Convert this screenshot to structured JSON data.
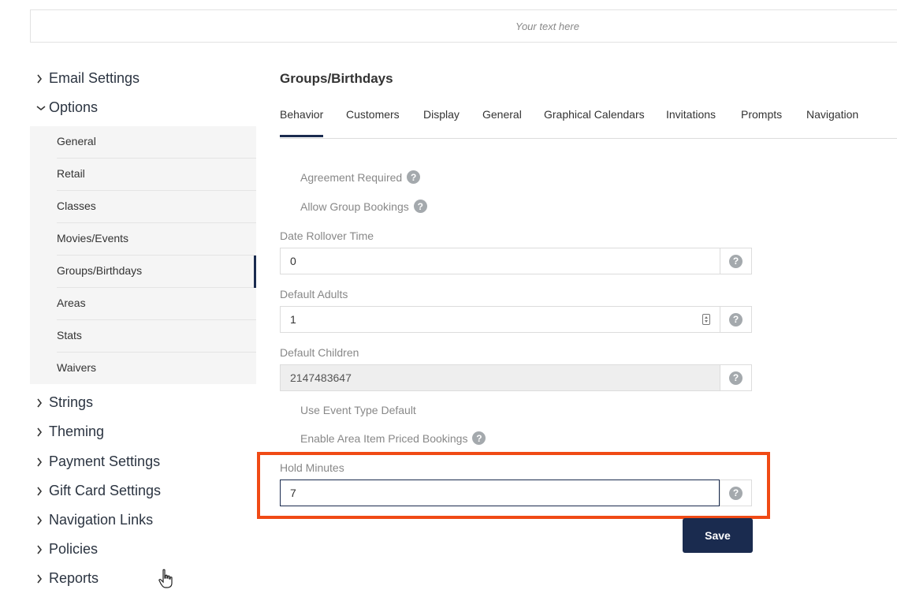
{
  "banner": {
    "text": "Your text here"
  },
  "sidebar": {
    "sections_top": [
      {
        "label": "Email Settings",
        "expanded": false
      },
      {
        "label": "Options",
        "expanded": true
      }
    ],
    "options_items": [
      {
        "label": "General"
      },
      {
        "label": "Retail"
      },
      {
        "label": "Classes"
      },
      {
        "label": "Movies/Events"
      },
      {
        "label": "Groups/Birthdays",
        "active": true
      },
      {
        "label": "Areas"
      },
      {
        "label": "Stats"
      },
      {
        "label": "Waivers"
      }
    ],
    "sections_bottom": [
      {
        "label": "Strings"
      },
      {
        "label": "Theming"
      },
      {
        "label": "Payment Settings"
      },
      {
        "label": "Gift Card Settings"
      },
      {
        "label": "Navigation Links"
      },
      {
        "label": "Policies"
      },
      {
        "label": "Reports"
      }
    ]
  },
  "main": {
    "title": "Groups/Birthdays",
    "tabs": [
      {
        "label": "Behavior",
        "active": true
      },
      {
        "label": "Customers"
      },
      {
        "label": "Display"
      },
      {
        "label": "General"
      },
      {
        "label": "Graphical Calendars"
      },
      {
        "label": "Invitations"
      },
      {
        "label": "Prompts"
      },
      {
        "label": "Navigation"
      }
    ],
    "agreement_required": "Agreement Required",
    "allow_group_bookings": "Allow Group Bookings",
    "date_rollover_time": {
      "label": "Date Rollover Time",
      "value": "0"
    },
    "default_adults": {
      "label": "Default Adults",
      "value": "1"
    },
    "default_children": {
      "label": "Default Children",
      "value": "2147483647"
    },
    "use_event_type_default": "Use Event Type Default",
    "enable_area_item_priced": "Enable Area Item Priced Bookings",
    "hold_minutes": {
      "label": "Hold Minutes",
      "value": "7"
    },
    "help_glyph": "?",
    "save_label": "Save"
  },
  "colors": {
    "accent": "#1a2b4f",
    "highlight": "#f04a15"
  }
}
